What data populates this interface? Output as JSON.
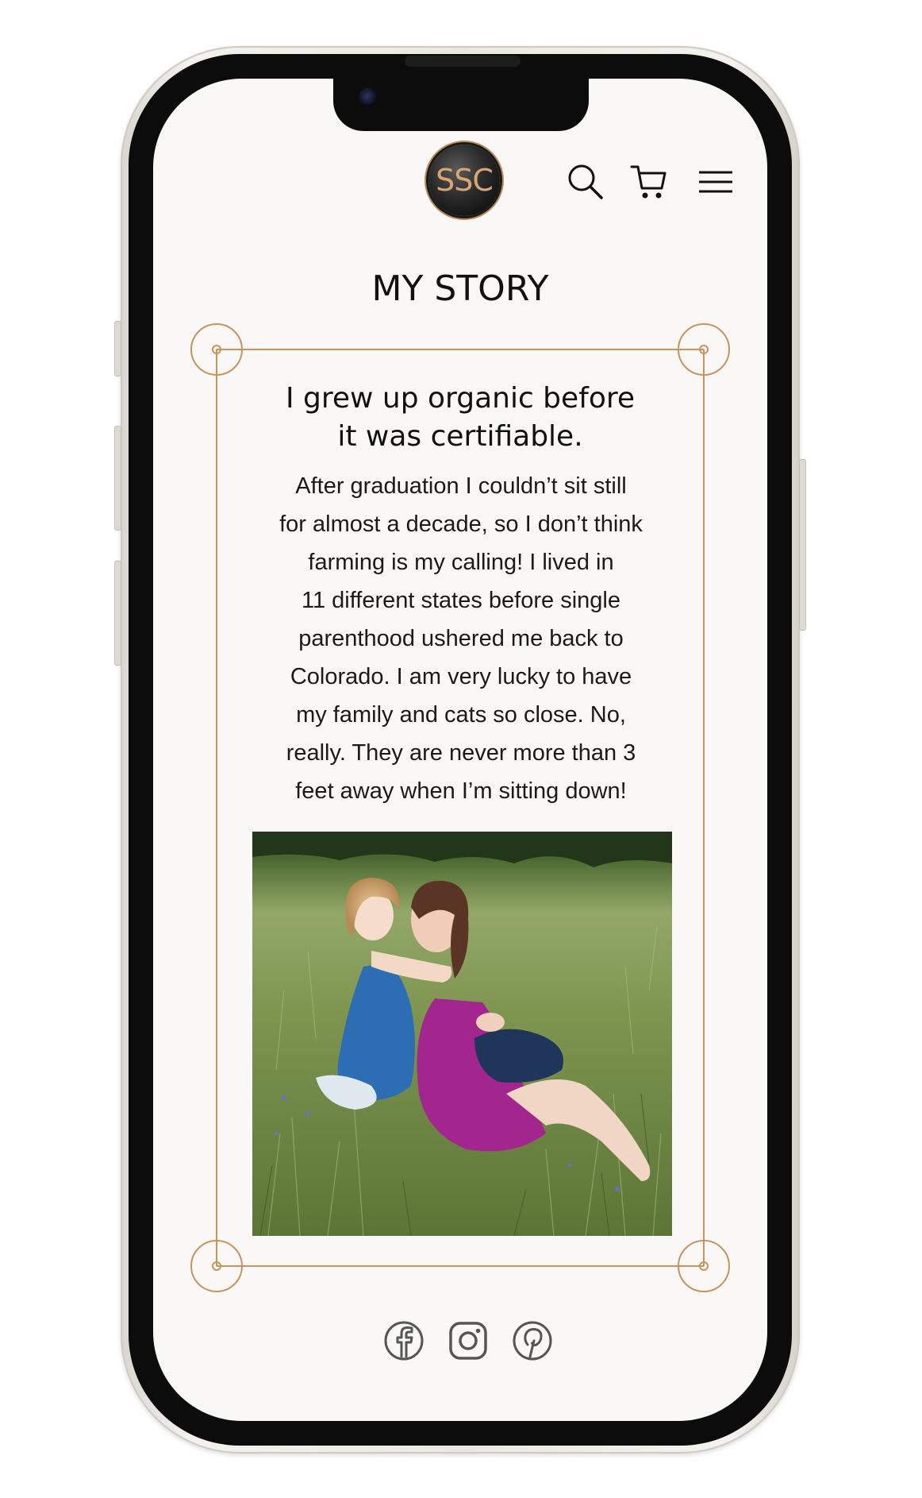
{
  "header": {
    "logo_text": "SSC",
    "icons": [
      "search-icon",
      "cart-icon",
      "menu-icon"
    ]
  },
  "page": {
    "title": "MY STORY",
    "subtitle_line1": "I grew up organic before",
    "subtitle_line2": "it was certifiable.",
    "body": [
      "After graduation I couldn’t sit still",
      "for almost a decade, so I don’t think",
      "farming is my calling!  I lived in",
      "11 different states before single",
      "parenthood ushered me back to",
      "Colorado.  I am very lucky to have",
      "my family and cats so close.  No,",
      "really.  They are never more than 3",
      "feet away when I’m sitting down!"
    ]
  },
  "footer": {
    "social_icons": [
      "facebook-icon",
      "instagram-icon",
      "pinterest-icon"
    ]
  },
  "colors": {
    "accent": "#c9935f",
    "background": "#f9f8f6",
    "text": "#111111",
    "icon": "#555555"
  }
}
